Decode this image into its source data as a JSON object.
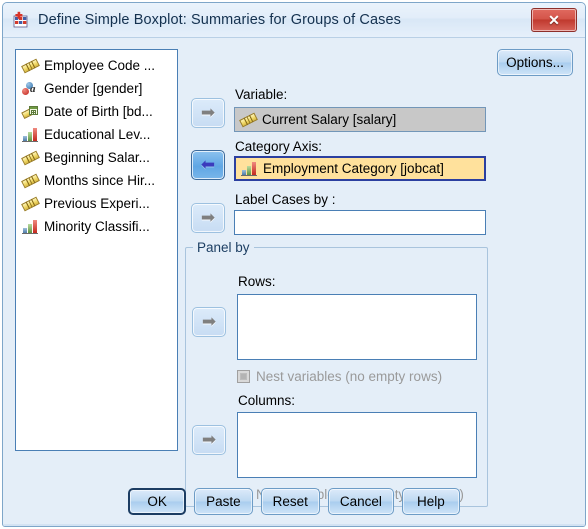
{
  "window": {
    "title": "Define Simple Boxplot: Summaries for Groups of Cases",
    "icon": "spss-dialog-icon",
    "close_label": "✕"
  },
  "variable_list": {
    "items": [
      {
        "label": "Employee Code ...",
        "icon": "scale-ruler-icon"
      },
      {
        "label": "Gender [gender]",
        "icon": "nominal-string-icon"
      },
      {
        "label": "Date of Birth [bd...",
        "icon": "date-icon"
      },
      {
        "label": "Educational Lev...",
        "icon": "nominal-bars-icon"
      },
      {
        "label": "Beginning Salar...",
        "icon": "scale-ruler-icon"
      },
      {
        "label": "Months since Hir...",
        "icon": "scale-ruler-icon"
      },
      {
        "label": "Previous Experi...",
        "icon": "scale-ruler-icon"
      },
      {
        "label": "Minority Classifi...",
        "icon": "nominal-bars-icon"
      }
    ]
  },
  "fields": {
    "variable": {
      "label": "Variable:",
      "value": "Current Salary [salary]",
      "icon": "scale-ruler-icon",
      "arrow_glyph": "➡",
      "state": "selected-inactive"
    },
    "category_axis": {
      "label": "Category Axis:",
      "value": "Employment Category [jobcat]",
      "icon": "nominal-bars-icon",
      "arrow_glyph": "⬅",
      "state": "focused"
    },
    "label_cases_by": {
      "label": "Label Cases by :",
      "value": "",
      "arrow_glyph": "➡",
      "state": "empty"
    }
  },
  "panel_by": {
    "title": "Panel by",
    "rows": {
      "label": "Rows:",
      "value": "",
      "arrow_glyph": "➡",
      "nest_label": "Nest variables (no empty rows)",
      "nest_checked": false,
      "nest_enabled": false
    },
    "columns": {
      "label": "Columns:",
      "value": "",
      "arrow_glyph": "➡",
      "nest_label": "Nest variables (no empty columns)",
      "nest_checked": false,
      "nest_enabled": false
    }
  },
  "options_button": {
    "label": "Options..."
  },
  "buttons": [
    {
      "label": "OK",
      "default": true
    },
    {
      "label": "Paste",
      "default": false
    },
    {
      "label": "Reset",
      "default": false
    },
    {
      "label": "Cancel",
      "default": false
    },
    {
      "label": "Help",
      "default": false
    }
  ],
  "colors": {
    "dialog_background": "#e4eef8",
    "titlebar": "#e2edf9",
    "field_border": "#4a7fb5",
    "focused_field_background": "#ffe19c",
    "focused_field_border": "#2b3fa0",
    "selected_inactive_background": "#c8c8c8",
    "close_button": "#c0392e",
    "active_arrow_button": "#5fa6e4",
    "disabled_text": "#9a9a9a"
  }
}
